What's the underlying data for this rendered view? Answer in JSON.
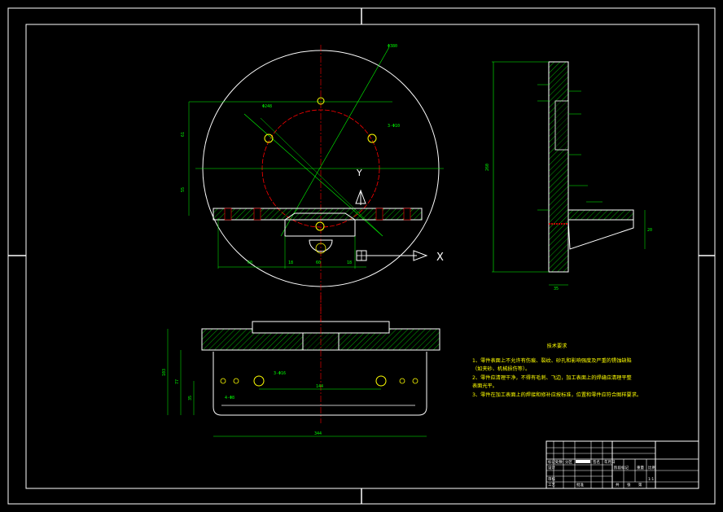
{
  "drawing": {
    "background": "#000000",
    "colors": {
      "frame": "#ffffff",
      "outline": "#ffffff",
      "dimension": "#00ff00",
      "center_line": "#ff0000",
      "hatch": "#00ff00",
      "hole": "#ffff00",
      "note_text": "#ffff00"
    }
  },
  "tech_requirements": {
    "title": "技术要求",
    "items": [
      "1、零件表面上不允许有伤痕、裂纹、砂孔和影响强度及严重的锈蚀缺陷",
      "（如夹砂、机械损伤等）。",
      "2、零件应清理干净，不得有毛刺、飞边，加工表面上的焊缝应清理平整",
      "表面光平。",
      "3、零件在加工表面上的焊接和修补应按标准，位置和零件应符合图样要求。"
    ]
  },
  "labels": {
    "axis_x": "X",
    "axis_y": "Y"
  },
  "dimensions": {
    "d_big": "Φ380",
    "pcd": "Φ248",
    "holes": "3-Φ10",
    "v1": "61",
    "v2": "55",
    "h_left": "60",
    "h_mid": "60",
    "h_small1": "18",
    "h_small2": "18",
    "side_height": "260",
    "side_w1": "20",
    "side_w2": "35",
    "bottom_width": "344",
    "bottom_inner": "144",
    "bottom_h1": "103",
    "bottom_h2": "77",
    "bottom_h3": "35",
    "bottom_slot": "4-Φ8",
    "bottom_holes": "3-Φ16"
  },
  "title_block": {
    "cells": [
      "标记",
      "处数",
      "分区",
      "更改文件号",
      "签名",
      "年月日",
      "设计",
      "审核",
      "工艺",
      "标准化",
      "批准",
      "阶段标记",
      "重量",
      "比例",
      "1:1",
      "共",
      "张",
      "第"
    ]
  }
}
